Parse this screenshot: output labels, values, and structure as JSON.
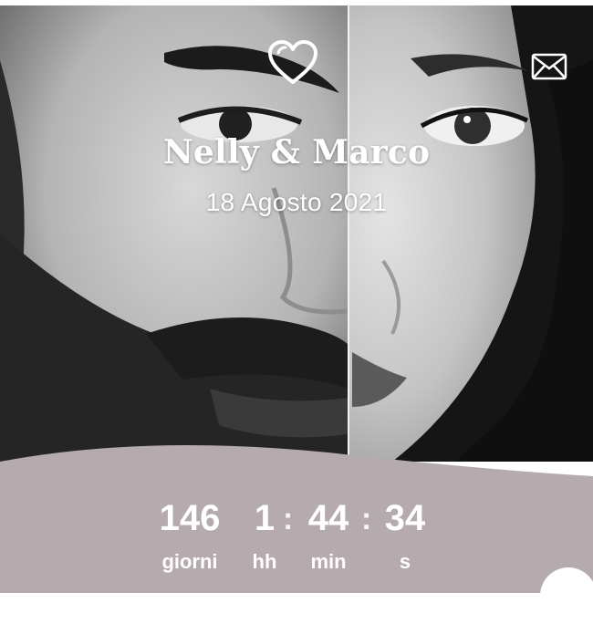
{
  "couple": {
    "names": "Nelly & Marco",
    "date": "18 Agosto 2021"
  },
  "countdown": {
    "days": {
      "value": "146",
      "label": "giorni"
    },
    "hours": {
      "value": "1",
      "label": "hh"
    },
    "minutes": {
      "value": "44",
      "label": "min"
    },
    "seconds": {
      "value": "34",
      "label": "s"
    },
    "separator": ":"
  },
  "icons": {
    "heart": "heart-icon",
    "envelope": "envelope-icon"
  },
  "colors": {
    "panel": "#b5aaae",
    "text": "#ffffff"
  }
}
